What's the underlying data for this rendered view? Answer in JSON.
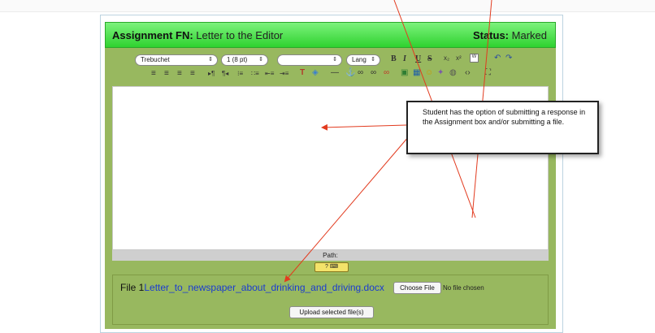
{
  "header": {
    "title_label": "Assignment FN:",
    "title_value": "Letter to the Editor",
    "status_label": "Status:",
    "status_value": "Marked"
  },
  "toolbar": {
    "font_family": "Trebuchet",
    "font_size": "1 (8 pt)",
    "format": "",
    "lang": "Lang",
    "bold": "B",
    "italic": "I",
    "underline": "U",
    "strike": "S",
    "subscript": "x₂",
    "superscript": "x²",
    "undo": "↶",
    "redo": "↷",
    "align_left": "≡",
    "align_center": "≡",
    "align_right": "≡",
    "align_justify": "≡",
    "ltr": "▸¶",
    "rtl": "¶◂",
    "ordered_list": "⁝≡",
    "unordered_list": "∷≡",
    "outdent": "⇤≡",
    "indent": "⇥≡",
    "text_color": "T",
    "bg_color": "◈",
    "hr": "—",
    "anchor": "⚓",
    "link": "∞",
    "unlink": "∞",
    "nolink": "∞",
    "image": "▣",
    "table": "▦",
    "smiley": "☺",
    "special_char": "✦",
    "search": "◍",
    "html": "‹›",
    "fullscreen": "⛶"
  },
  "editor": {
    "path_label": "Path:",
    "help_badge": "?"
  },
  "files": {
    "file_label": "File 1",
    "file_link": "Letter_to_newspaper_about_drinking_and_driving.docx",
    "choose_button": "Choose File",
    "no_file_text": "No file chosen",
    "upload_button": "Upload selected file(s)"
  },
  "callout": {
    "text": "Student has the option of submitting a response in the Assignment box and/or submitting a file."
  },
  "colors": {
    "header_green": "#2fd22f",
    "panel_green": "#98b85f",
    "link_blue": "#1a3bd1",
    "arrow_red": "#e23b1f"
  }
}
